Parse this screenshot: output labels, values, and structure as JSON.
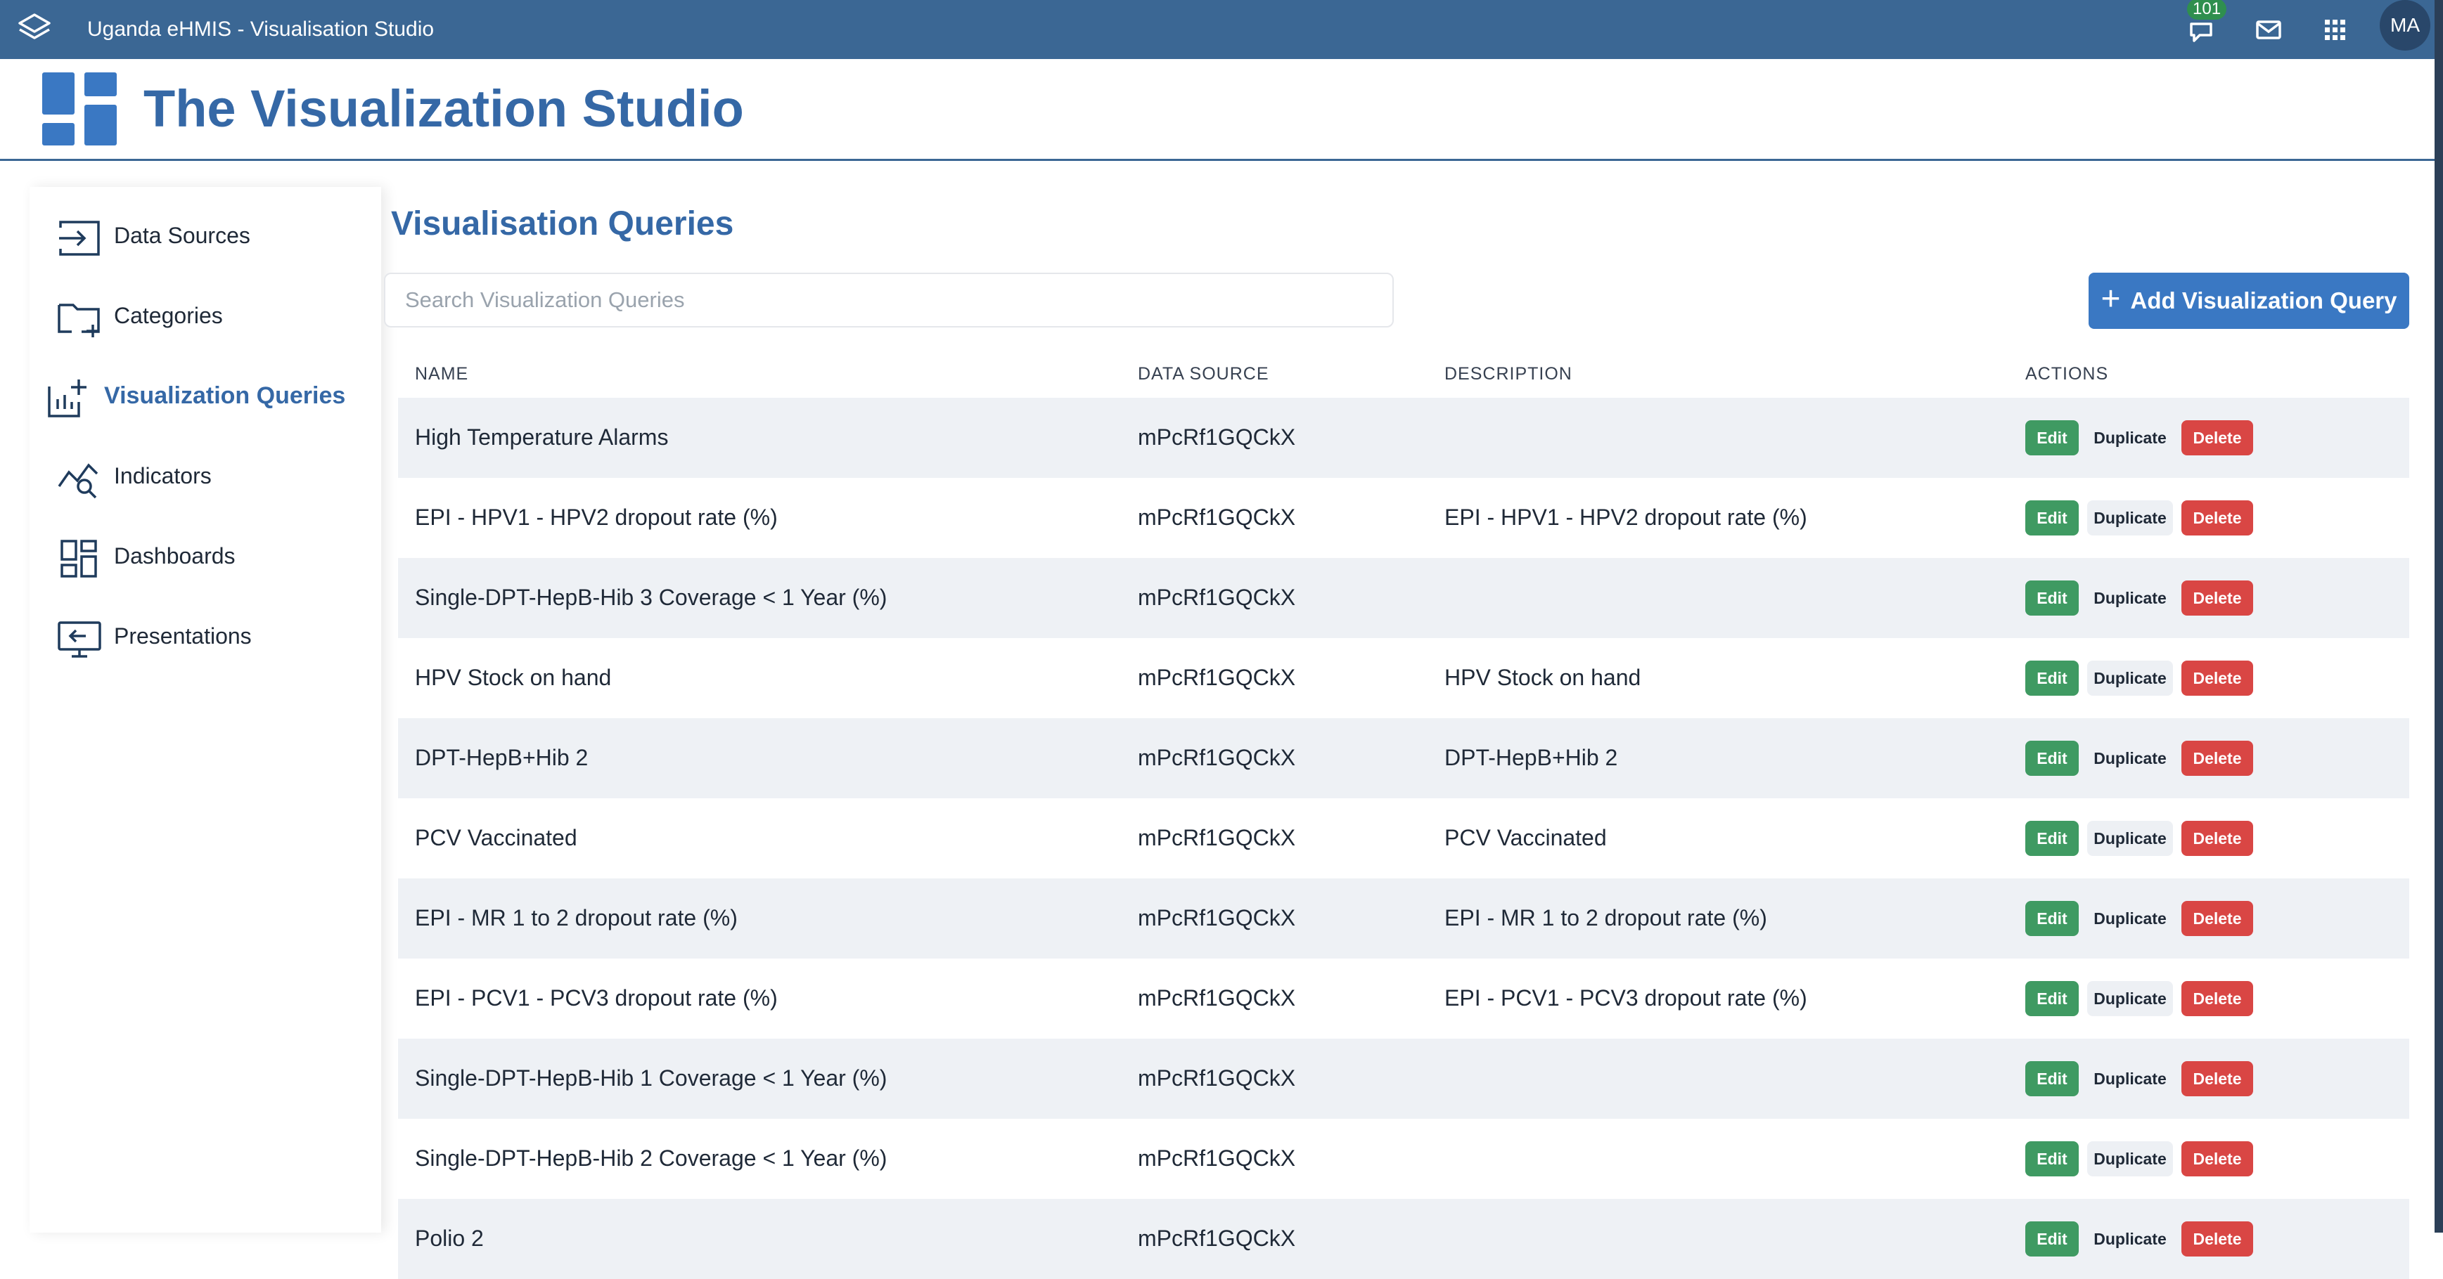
{
  "header": {
    "app_title": "Uganda eHMIS - Visualisation Studio",
    "notification_count": "101",
    "avatar_initials": "MA",
    "icons": [
      "layers-icon",
      "chat-icon",
      "mail-icon",
      "apps-grid-icon"
    ]
  },
  "brand": {
    "title": "The Visualization Studio"
  },
  "sidebar": {
    "items": [
      {
        "label": "Data Sources",
        "icon": "input-arrow-icon",
        "active": false
      },
      {
        "label": "Categories",
        "icon": "folder-plus-icon",
        "active": false
      },
      {
        "label": "Visualization Queries",
        "icon": "chart-add-icon",
        "active": true
      },
      {
        "label": "Indicators",
        "icon": "trend-search-icon",
        "active": false
      },
      {
        "label": "Dashboards",
        "icon": "dashboard-icon",
        "active": false
      },
      {
        "label": "Presentations",
        "icon": "presentation-icon",
        "active": false
      }
    ]
  },
  "main": {
    "title": "Visualisation Queries",
    "search_placeholder": "Search Visualization Queries",
    "add_button_label": "Add Visualization Query",
    "table": {
      "columns": [
        "NAME",
        "DATA SOURCE",
        "DESCRIPTION",
        "ACTIONS"
      ],
      "action_labels": {
        "edit": "Edit",
        "duplicate": "Duplicate",
        "delete": "Delete"
      },
      "rows": [
        {
          "name": "High Temperature Alarms",
          "data_source": "mPcRf1GQCkX",
          "description": ""
        },
        {
          "name": "EPI - HPV1 - HPV2 dropout rate (%)",
          "data_source": "mPcRf1GQCkX",
          "description": "EPI - HPV1 - HPV2 dropout rate (%)"
        },
        {
          "name": "Single-DPT-HepB-Hib 3 Coverage < 1 Year (%)",
          "data_source": "mPcRf1GQCkX",
          "description": ""
        },
        {
          "name": "HPV Stock on hand",
          "data_source": "mPcRf1GQCkX",
          "description": "HPV Stock on hand"
        },
        {
          "name": "DPT-HepB+Hib 2",
          "data_source": "mPcRf1GQCkX",
          "description": "DPT-HepB+Hib 2"
        },
        {
          "name": "PCV Vaccinated",
          "data_source": "mPcRf1GQCkX",
          "description": "PCV Vaccinated"
        },
        {
          "name": "EPI - MR 1 to 2 dropout rate (%)",
          "data_source": "mPcRf1GQCkX",
          "description": "EPI - MR 1 to 2 dropout rate (%)"
        },
        {
          "name": "EPI - PCV1 - PCV3 dropout rate (%)",
          "data_source": "mPcRf1GQCkX",
          "description": "EPI - PCV1 - PCV3 dropout rate (%)"
        },
        {
          "name": "Single-DPT-HepB-Hib 1 Coverage < 1 Year (%)",
          "data_source": "mPcRf1GQCkX",
          "description": ""
        },
        {
          "name": "Single-DPT-HepB-Hib 2 Coverage < 1 Year (%)",
          "data_source": "mPcRf1GQCkX",
          "description": ""
        },
        {
          "name": "Polio 2",
          "data_source": "mPcRf1GQCkX",
          "description": ""
        }
      ]
    }
  },
  "colors": {
    "header_bg": "#3b6794",
    "accent": "#3568a6",
    "primary_button": "#3a78c3",
    "edit": "#3f9a62",
    "delete": "#d94644",
    "row_stripe": "#eef1f5"
  }
}
